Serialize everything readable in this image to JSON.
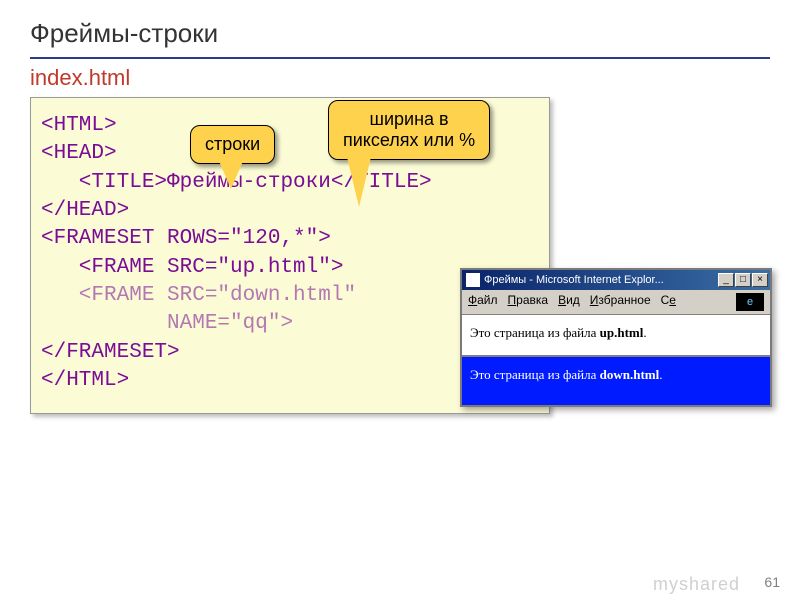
{
  "title": "Фреймы-строки",
  "filename": "index.html",
  "code": [
    {
      "text": "<HTML>",
      "cls": "kw"
    },
    {
      "text": "<HEAD>",
      "cls": "kw"
    },
    {
      "text": "   <TITLE>Фреймы-строки</TITLE>",
      "cls": "kw"
    },
    {
      "text": "</HEAD>",
      "cls": "kw"
    },
    {
      "text": "<FRAMESET ROWS=\"120,*\">",
      "cls": "kw"
    },
    {
      "text": "   <FRAME SRC=\"up.html\">",
      "cls": "kw"
    },
    {
      "text": "   <FRAME SRC=\"down.html\"",
      "cls": "dim"
    },
    {
      "text": "          NAME=\"qq\">",
      "cls": "dim"
    },
    {
      "text": "</FRAMESET>",
      "cls": "kw"
    },
    {
      "text": "</HTML>",
      "cls": "kw"
    }
  ],
  "callouts": {
    "c1": "строки",
    "c2": "ширина в\nпикселях или %"
  },
  "browser": {
    "title": "Фреймы - Microsoft Internet Explor...",
    "menu": [
      "Файл",
      "Правка",
      "Вид",
      "Избранное",
      "Се"
    ],
    "frame_top": "Это страница из файла up.html.",
    "frame_bottom": "Это страница из файла down.html."
  },
  "pagenum": "61",
  "watermark": "myshared"
}
